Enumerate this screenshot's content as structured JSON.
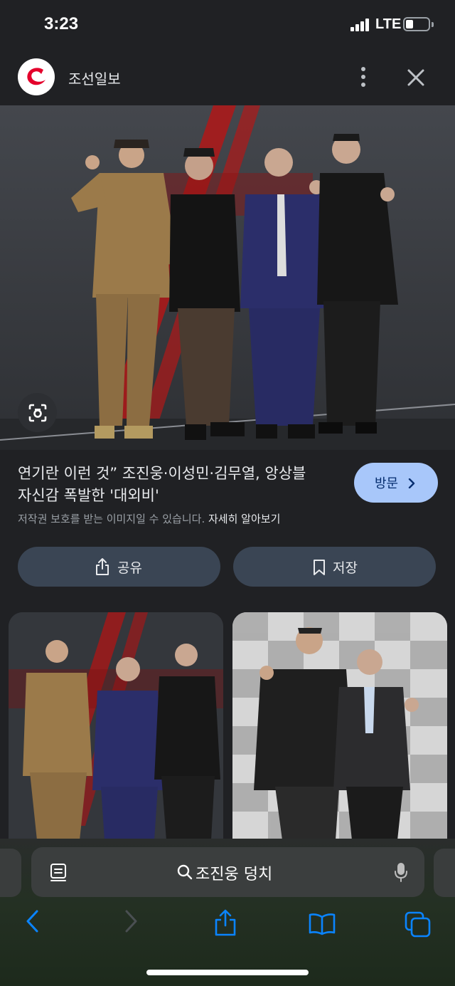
{
  "status_bar": {
    "time": "3:23",
    "network": "LTE"
  },
  "header": {
    "site_name": "조선일보",
    "logo_icon": "chosun-logo",
    "more_icon": "more-vertical-icon",
    "close_icon": "close-icon"
  },
  "image": {
    "alt": "조진웅·이성민·김무열 포토콜 사진"
  },
  "result": {
    "title_line1": "연기란 이런 것” 조진웅·이성민·김무열, 앙상블",
    "title_line2": "자신감 폭발한 '대외비'",
    "visit_label": "방문",
    "copyright_text": "저작권 보호를 받는 이미지일 수 있습니다.",
    "copyright_link": "자세히 알아보기"
  },
  "actions": {
    "share_label": "공유",
    "save_label": "저장"
  },
  "browser": {
    "search_query": "조진웅 덩치"
  },
  "colors": {
    "accent": "#a8c7fa",
    "action_bg": "#3a4554",
    "background": "#202124",
    "ios_blue": "#0a84ff"
  }
}
